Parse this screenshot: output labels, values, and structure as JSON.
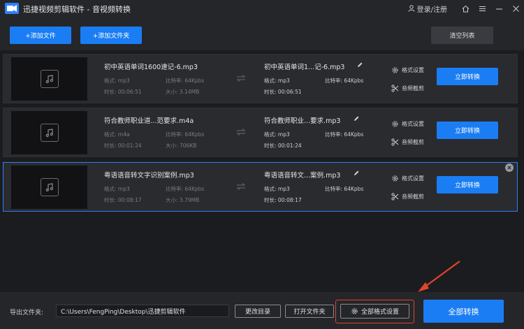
{
  "app": {
    "title": "迅捷视频剪辑软件 - 音视频转换",
    "login_label": "登录/注册"
  },
  "toolbar": {
    "add_file": "+添加文件",
    "add_folder": "+添加文件夹",
    "clear_list": "清空列表"
  },
  "labels": {
    "format": "格式:",
    "duration": "时长:",
    "bitrate": "比特率:",
    "size": "大小:",
    "format_settings": "格式设置",
    "audio_trim": "音频截剪",
    "convert_now": "立即转换"
  },
  "files": [
    {
      "name": "初中英语单词1600速记-6.mp3",
      "format": "mp3",
      "duration": "00:06:51",
      "bitrate": "64Kpbs",
      "size": "3.14MB",
      "out_name": "初中英语单词1...记-6.mp3",
      "out_format": "mp3",
      "out_bitrate": "64Kpbs",
      "out_duration": "00:06:51"
    },
    {
      "name": "符合教师职业道...范要求.m4a",
      "format": "m4a",
      "duration": "00:01:24",
      "bitrate": "64Kpbs",
      "size": "706KB",
      "out_name": "符合教师职业...要求.mp3",
      "out_format": "mp3",
      "out_bitrate": "64Kpbs",
      "out_duration": "00:01:24"
    },
    {
      "name": "粤语语音转文字识别案例.mp3",
      "format": "mp3",
      "duration": "00:08:17",
      "bitrate": "64Kpbs",
      "size": "3.79MB",
      "out_name": "粤语语音转文...案例.mp3",
      "out_format": "mp3",
      "out_bitrate": "64Kpbs",
      "out_duration": "00:08:17"
    }
  ],
  "bottom": {
    "export_label": "导出文件夹:",
    "path": "C:\\Users\\FengPing\\Desktop\\迅捷剪辑软件",
    "change_dir": "更改目录",
    "open_folder": "打开文件夹",
    "all_format_settings": "全部格式设置",
    "convert_all": "全部转换"
  },
  "colors": {
    "accent": "#1b7df3",
    "annotation": "#e0442d"
  }
}
